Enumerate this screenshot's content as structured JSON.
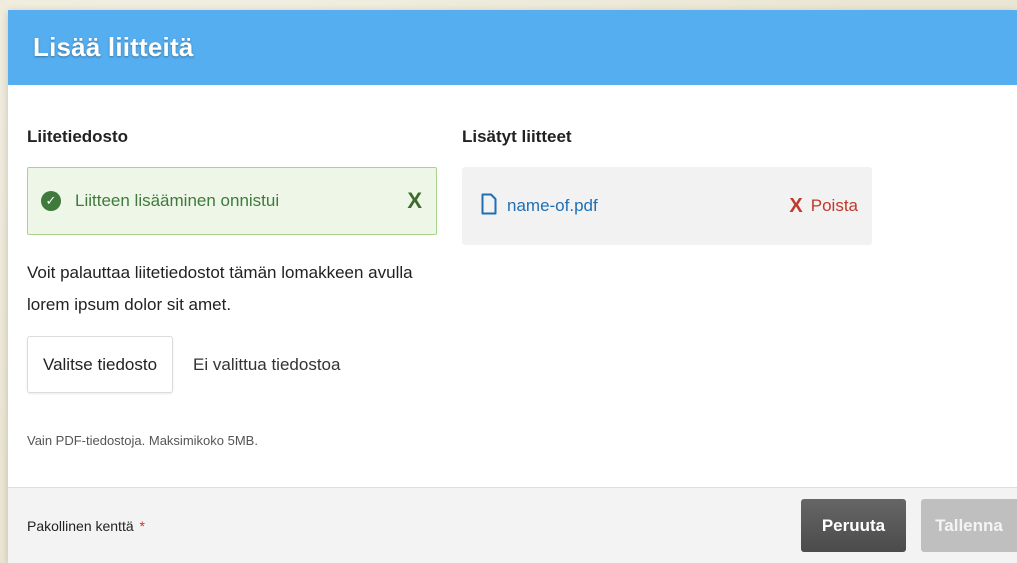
{
  "colors": {
    "header": "#55aef0",
    "success": "#3f7a3c",
    "link": "#1f6fb2",
    "danger": "#c0392b",
    "cancel_button": "#555555",
    "save_button_disabled": "#bfbfbf"
  },
  "modal": {
    "title": "Lisää liitteitä"
  },
  "left": {
    "section_title": "Liitetiedosto",
    "alert": {
      "icon": "check-circle-icon",
      "message": "Liitteen lisääminen onnistui",
      "dismiss_symbol": "X"
    },
    "help_text_line1": "Voit palauttaa liitetiedostot tämän lomakkeen avulla",
    "help_text_line2": "lorem ipsum dolor sit amet.",
    "choose_button_label": "Valitse tiedosto",
    "no_file_text": "Ei valittua tiedostoa",
    "hint": "Vain PDF-tiedostoja. Maksimikoko 5MB."
  },
  "right": {
    "section_title": "Lisätyt liitteet",
    "files": [
      {
        "name": "name-of.pdf",
        "icon": "file-icon",
        "remove_label": "Poista",
        "remove_symbol": "X"
      }
    ]
  },
  "footer": {
    "required_label": "Pakollinen kenttä",
    "required_star": "*",
    "cancel_label": "Peruuta",
    "save_label": "Tallenna"
  }
}
